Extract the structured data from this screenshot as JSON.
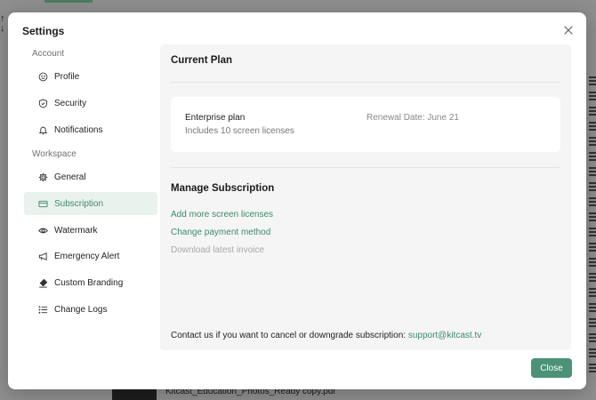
{
  "background": {
    "file_name": "Kitcast_Education_Photos_Ready copy.pdf"
  },
  "modal": {
    "title": "Settings",
    "close_icon": "close-icon"
  },
  "sidebar": {
    "account_label": "Account",
    "workspace_label": "Workspace",
    "account_items": [
      {
        "label": "Profile",
        "icon": "smiley-icon"
      },
      {
        "label": "Security",
        "icon": "shield-icon"
      },
      {
        "label": "Notifications",
        "icon": "bell-icon"
      }
    ],
    "workspace_items": [
      {
        "label": "General",
        "icon": "gear-icon"
      },
      {
        "label": "Subscription",
        "icon": "credit-card-icon",
        "active": true
      },
      {
        "label": "Watermark",
        "icon": "eye-icon"
      },
      {
        "label": "Emergency Alert",
        "icon": "megaphone-icon"
      },
      {
        "label": "Custom Branding",
        "icon": "brush-icon"
      },
      {
        "label": "Change Logs",
        "icon": "list-icon"
      }
    ]
  },
  "content": {
    "current_plan_title": "Current Plan",
    "plan": {
      "name": "Enterprise plan",
      "description": "Includes 10 screen licenses",
      "renewal": "Renewal Date: June 21"
    },
    "manage_title": "Manage Subscription",
    "links": {
      "add_licenses": "Add more screen licenses",
      "change_payment": "Change payment method",
      "download_invoice": "Download latest invoice"
    },
    "contact_text": "Contact us if you want to cancel or downgrade subscription:",
    "contact_email": "support@kitcast.tv"
  },
  "footer": {
    "close_label": "Close"
  },
  "colors": {
    "accent": "#3c8a6a",
    "button": "#4b9276",
    "active_bg": "#eaf2ee",
    "panel_bg": "#f5f5f5"
  }
}
